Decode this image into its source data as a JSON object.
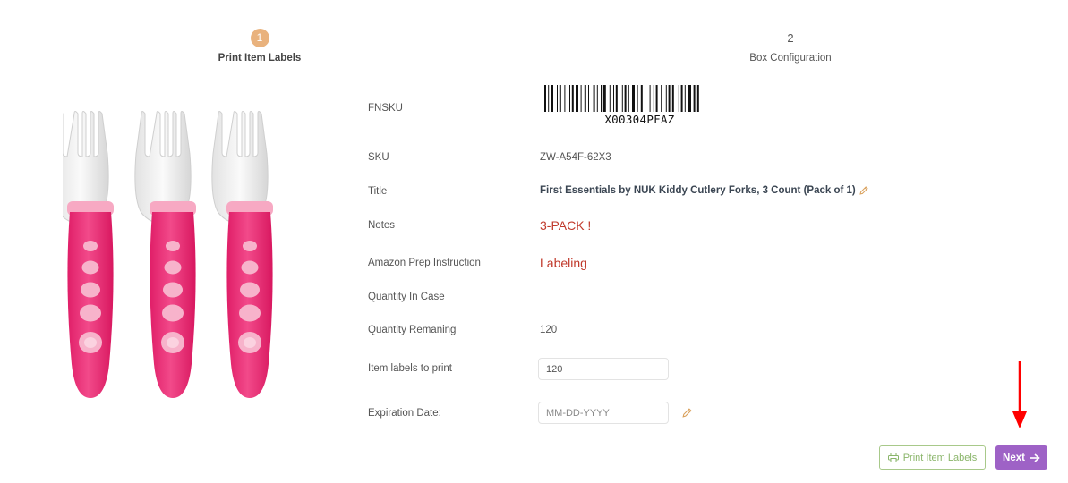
{
  "stepper": {
    "steps": [
      {
        "number": "1",
        "label": "Print Item Labels",
        "active": true
      },
      {
        "number": "2",
        "label": "Box Configuration",
        "active": false
      }
    ]
  },
  "product": {
    "image_icon": "pink-toddler-forks-image",
    "fnsku_label": "FNSKU",
    "barcode_text": "X00304PFAZ",
    "sku_label": "SKU",
    "sku_value": "ZW-A54F-62X3",
    "title_label": "Title",
    "title_value": "First Essentials by NUK Kiddy Cutlery Forks, 3 Count (Pack of 1)",
    "notes_label": "Notes",
    "notes_value": "3-PACK !",
    "prep_label": "Amazon Prep Instruction",
    "prep_value": "Labeling",
    "qty_case_label": "Quantity In Case",
    "qty_remaining_label": "Quantity Remaning",
    "qty_remaining_value": "120",
    "labels_to_print_label": "Item labels to print",
    "labels_to_print_value": "120",
    "expiration_label": "Expiration Date:",
    "expiration_placeholder": "MM-DD-YYYY"
  },
  "actions": {
    "print_label": "Print Item Labels",
    "next_label": "Next"
  },
  "colors": {
    "step_active": "#e9b27d",
    "accent_red": "#c0392b",
    "print_border": "#a8c98a",
    "print_text": "#8ab56a",
    "next_bg": "#9e62c6",
    "edit_icon": "#d9a05b",
    "annotation_arrow": "#ff0000"
  }
}
